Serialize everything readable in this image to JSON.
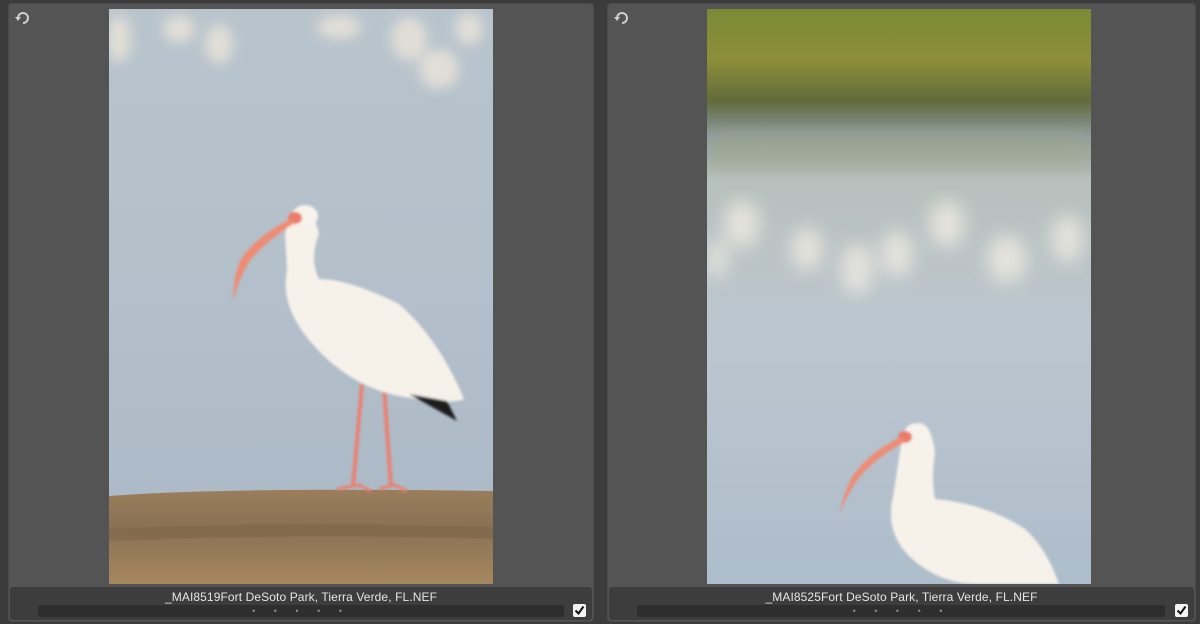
{
  "panels": [
    {
      "filename": "_MAI8519Fort DeSoto Park, Tierra Verde, FL.NEF",
      "rating_dots": [
        "•",
        "•",
        "•",
        "•",
        "•"
      ],
      "selected": true,
      "icons": {
        "rotate": "rotate-icon",
        "checkbox": "checkmark-icon"
      }
    },
    {
      "filename": "_MAI8525Fort DeSoto Park, Tierra Verde, FL.NEF",
      "rating_dots": [
        "•",
        "•",
        "•",
        "•",
        "•"
      ],
      "selected": true,
      "icons": {
        "rotate": "rotate-icon",
        "checkbox": "checkmark-icon"
      }
    }
  ],
  "colors": {
    "panel_bg": "#545454",
    "footer_bg": "#3d3d3d",
    "text": "#e6e6e6"
  }
}
